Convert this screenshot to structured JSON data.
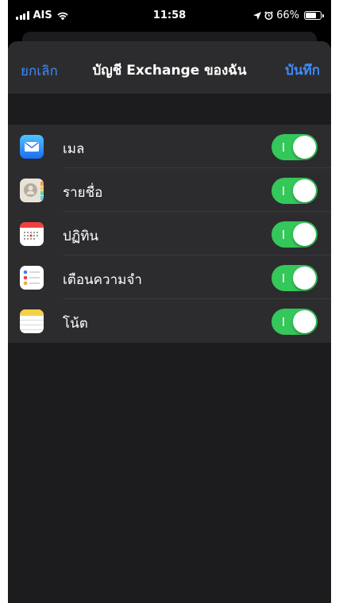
{
  "status_bar": {
    "carrier": "AIS",
    "time": "11:58",
    "battery": "66%"
  },
  "nav": {
    "cancel_label": "ยกเลิก",
    "title": "บัญชี Exchange ของฉัน",
    "save_label": "บันทึก"
  },
  "items": [
    {
      "label": "เมล",
      "icon": "mail-icon",
      "enabled": true
    },
    {
      "label": "รายชื่อ",
      "icon": "contacts-icon",
      "enabled": true
    },
    {
      "label": "ปฏิทิน",
      "icon": "calendar-icon",
      "enabled": true
    },
    {
      "label": "เตือนความจำ",
      "icon": "reminders-icon",
      "enabled": true
    },
    {
      "label": "โน้ต",
      "icon": "notes-icon",
      "enabled": true
    }
  ],
  "colors": {
    "accent": "#3d8bfd",
    "toggle_on": "#34c759",
    "background": "#000000",
    "cell": "#2c2c2e"
  }
}
